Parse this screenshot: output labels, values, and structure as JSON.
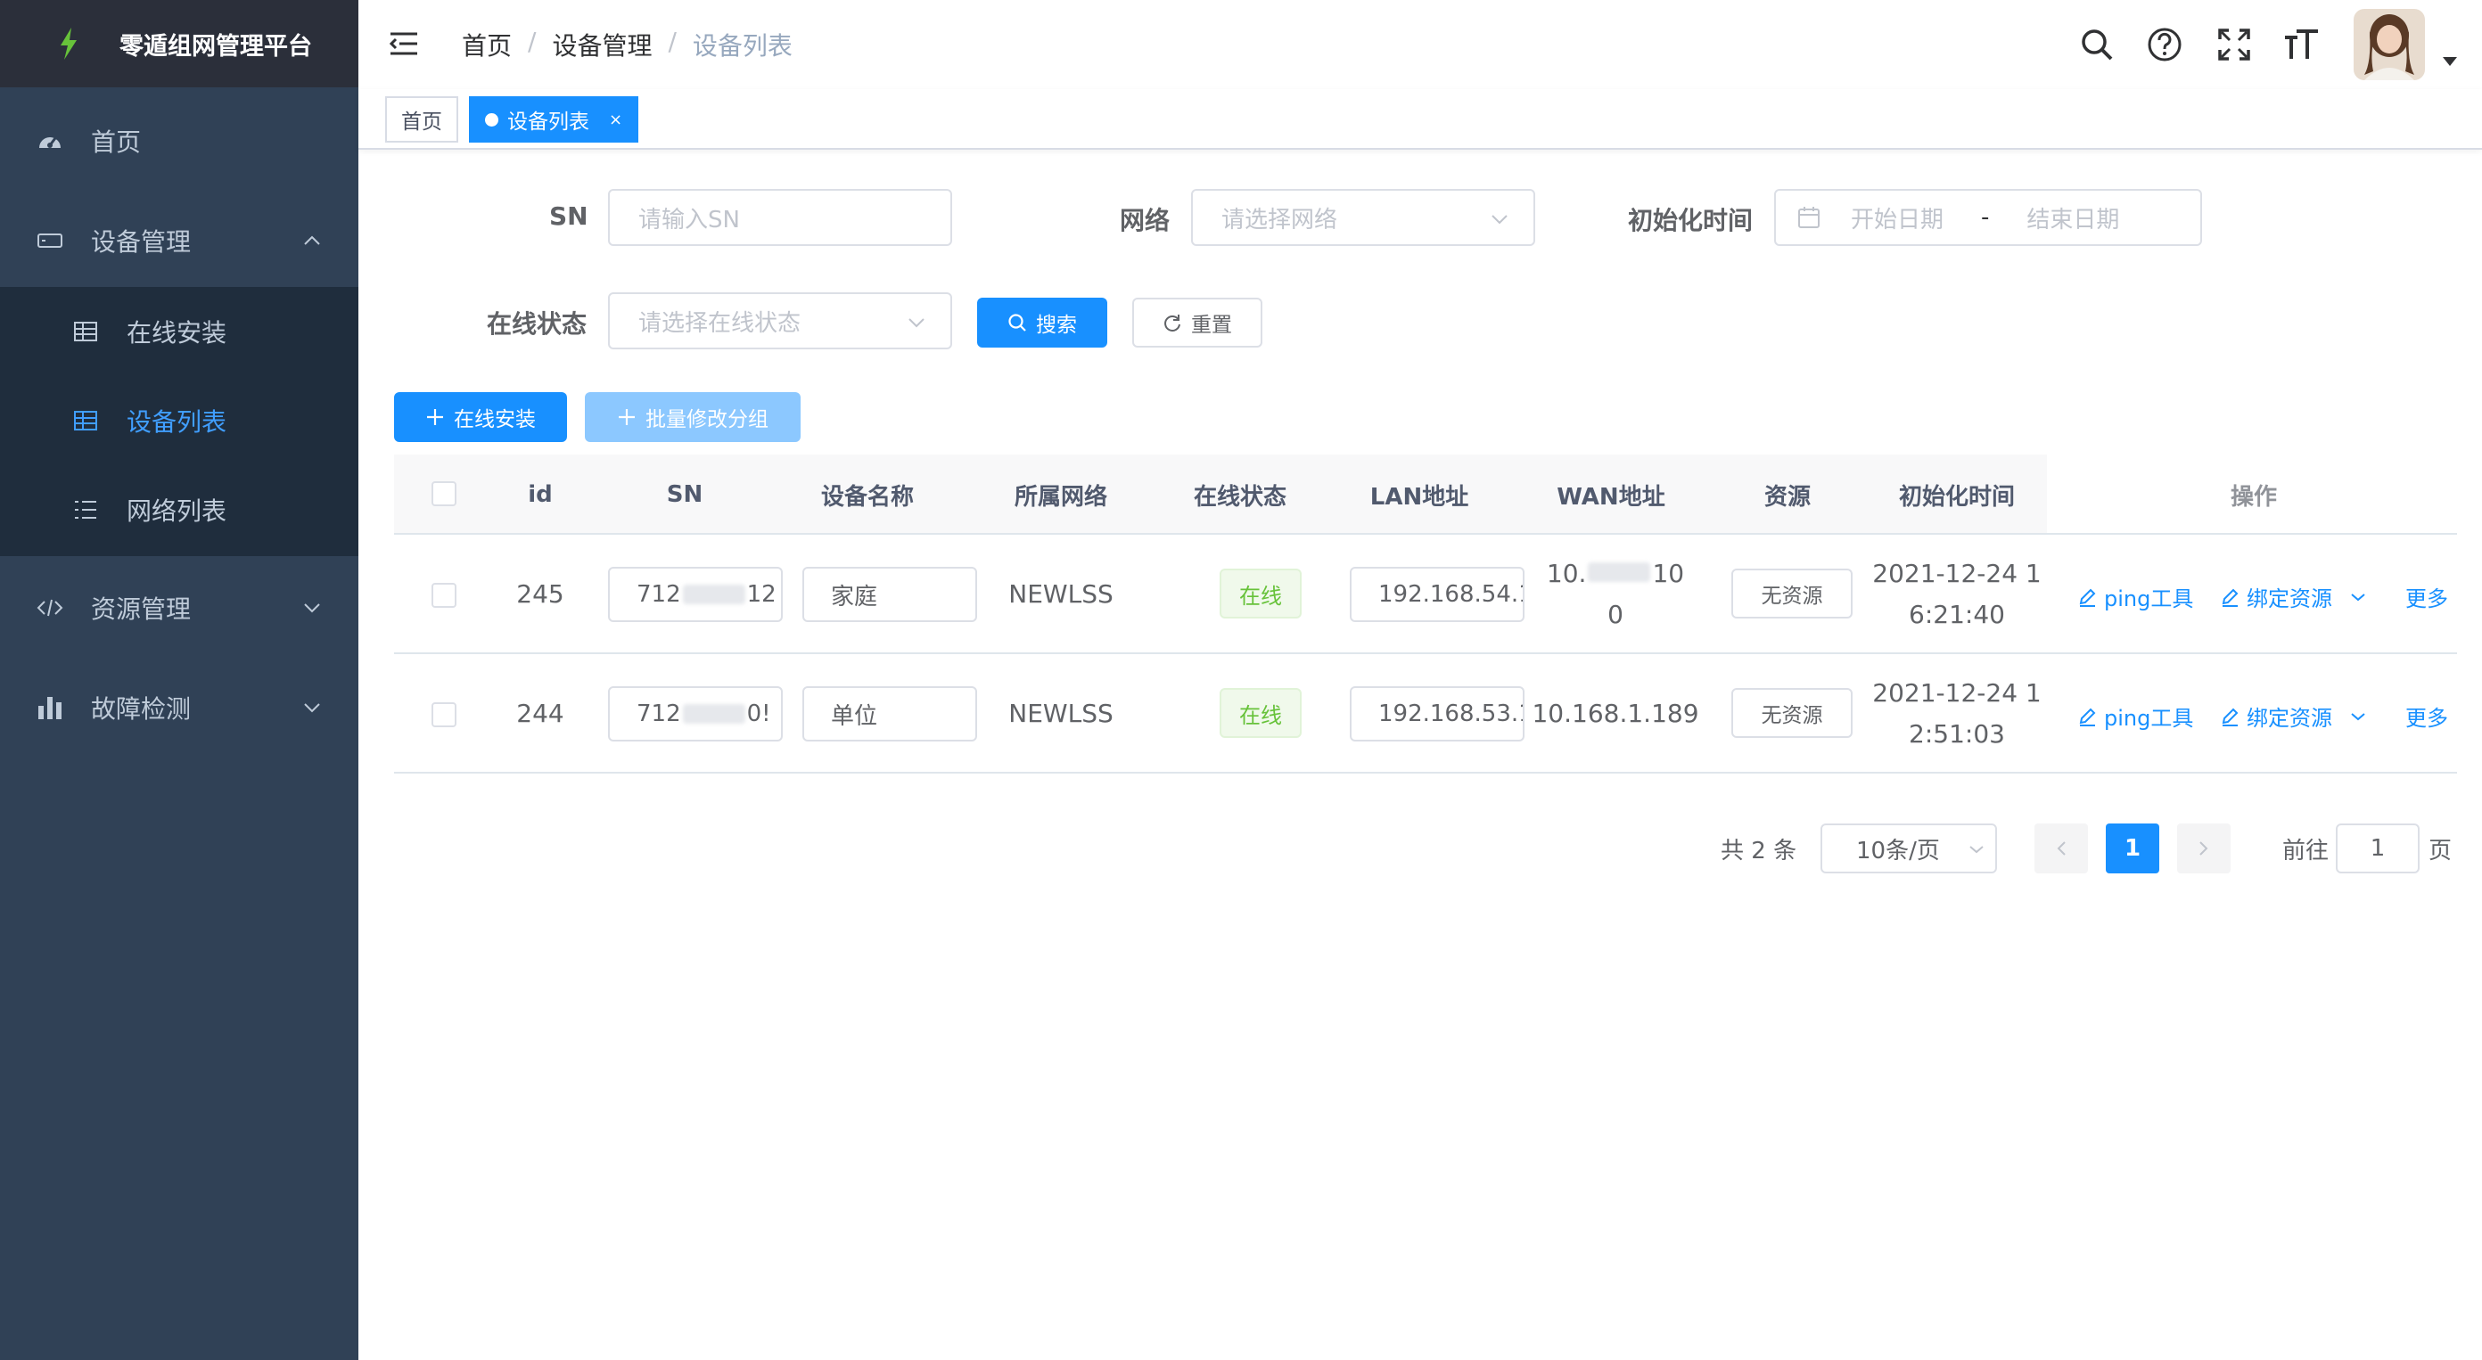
{
  "app": {
    "title": "零遁组网管理平台"
  },
  "sidebar": {
    "items": [
      {
        "label": "首页",
        "icon": "dashboard-icon"
      },
      {
        "label": "设备管理",
        "icon": "device-icon",
        "expanded": true,
        "children": [
          {
            "label": "在线安装",
            "icon": "table-icon"
          },
          {
            "label": "设备列表",
            "icon": "table-icon",
            "active": true
          },
          {
            "label": "网络列表",
            "icon": "list-icon"
          }
        ]
      },
      {
        "label": "资源管理",
        "icon": "code-icon"
      },
      {
        "label": "故障检测",
        "icon": "chart-icon"
      }
    ],
    "colors": {
      "bg": "#304156",
      "submenu_bg": "#1f2d3d",
      "text": "#bfcbd9",
      "active": "#409eff"
    }
  },
  "navbar": {
    "breadcrumb": [
      "首页",
      "设备管理",
      "设备列表"
    ],
    "icons": [
      "search-icon",
      "help-icon",
      "fullscreen-icon",
      "font-size-icon"
    ]
  },
  "tags": [
    {
      "label": "首页",
      "active": false
    },
    {
      "label": "设备列表",
      "active": true,
      "close": "×"
    }
  ],
  "filters": {
    "sn": {
      "label": "SN",
      "placeholder": "请输入SN"
    },
    "network": {
      "label": "网络",
      "placeholder": "请选择网络"
    },
    "init_time": {
      "label": "初始化时间",
      "start_placeholder": "开始日期",
      "separator": "-",
      "end_placeholder": "结束日期"
    },
    "status": {
      "label": "在线状态",
      "placeholder": "请选择在线状态"
    },
    "search_label": "搜索",
    "reset_label": "重置"
  },
  "toolbar": {
    "install_label": "在线安装",
    "batch_label": "批量修改分组"
  },
  "table": {
    "columns": [
      "id",
      "SN",
      "设备名称",
      "所属网络",
      "在线状态",
      "LAN地址",
      "WAN地址",
      "资源",
      "初始化时间",
      "操作"
    ],
    "rows": [
      {
        "id": "245",
        "sn_start": "712",
        "sn_end": "12",
        "name": "家庭",
        "network": "NEWLSS",
        "status": "在线",
        "lan": "192.168.54.1",
        "wan_start": "10.",
        "wan_end": "10",
        "wan_line2": "0",
        "resource": "无资源",
        "init_line1": "2021-12-24 1",
        "init_line2": "6:21:40"
      },
      {
        "id": "244",
        "sn_start": "712",
        "sn_end": "0!",
        "name": "单位",
        "network": "NEWLSS",
        "status": "在线",
        "lan": "192.168.53.1",
        "wan": "10.168.1.189",
        "resource": "无资源",
        "init_line1": "2021-12-24 1",
        "init_line2": "2:51:03"
      }
    ],
    "ops": {
      "ping": "ping工具",
      "bind": "绑定资源",
      "more": "更多"
    }
  },
  "pagination": {
    "total": "共 2 条",
    "page_size": "10条/页",
    "current": "1",
    "goto_prefix": "前往",
    "goto_value": "1",
    "goto_suffix": "页"
  },
  "colors": {
    "primary": "#1890ff",
    "success": "#67c23a",
    "border": "#dcdfe6"
  }
}
